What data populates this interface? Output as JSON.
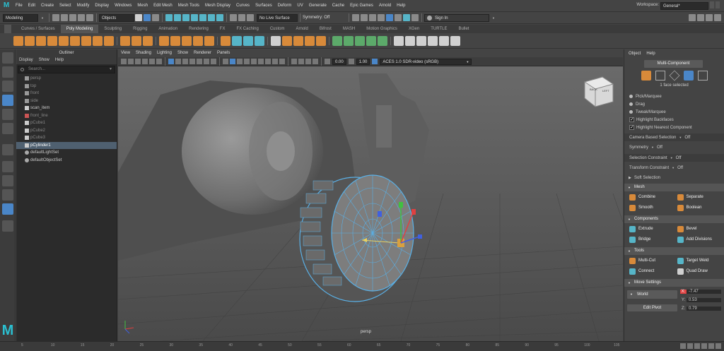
{
  "menubar": {
    "items": [
      "File",
      "Edit",
      "Create",
      "Select",
      "Modify",
      "Display",
      "Windows",
      "Mesh",
      "Edit Mesh",
      "Mesh Tools",
      "Mesh Display",
      "Curves",
      "Surfaces",
      "Deform",
      "UV",
      "Generate",
      "Cache",
      "Epic Games",
      "Arnold",
      "Help"
    ],
    "workspace_label": "Workspace:",
    "workspace_value": "General*"
  },
  "status": {
    "mode": "Modeling",
    "objects": "Objects",
    "live_surface": "No Live Surface",
    "symmetry": "Symmetry: Off",
    "signin": "Sign In"
  },
  "shelf_tabs": [
    "Curves / Surfaces",
    "Poly Modeling",
    "Sculpting",
    "Rigging",
    "Animation",
    "Rendering",
    "FX",
    "FX Caching",
    "Custom",
    "Arnold",
    "Bifrost",
    "MASH",
    "Motion Graphics",
    "XGen",
    "TURTLE",
    "Bullet"
  ],
  "active_shelf_tab": 1,
  "outliner": {
    "title": "Outliner",
    "menu": [
      "Display",
      "Show",
      "Help"
    ],
    "search_placeholder": "Search...",
    "items": [
      {
        "label": "persp",
        "kind": "camera",
        "dim": true
      },
      {
        "label": "top",
        "kind": "camera",
        "dim": true
      },
      {
        "label": "front",
        "kind": "camera",
        "dim": true
      },
      {
        "label": "side",
        "kind": "camera",
        "dim": true
      },
      {
        "label": "scan_item",
        "kind": "mesh",
        "dim": false
      },
      {
        "label": "front_line",
        "kind": "curve",
        "dim": true
      },
      {
        "label": "pCube1",
        "kind": "mesh",
        "dim": true
      },
      {
        "label": "pCube2",
        "kind": "mesh",
        "dim": true
      },
      {
        "label": "pCube3",
        "kind": "mesh",
        "dim": true
      },
      {
        "label": "pCylinder1",
        "kind": "mesh",
        "dim": false,
        "selected": true
      },
      {
        "label": "defaultLightSet",
        "kind": "set",
        "dim": false
      },
      {
        "label": "defaultObjectSet",
        "kind": "set",
        "dim": false
      }
    ]
  },
  "viewport": {
    "menu": [
      "View",
      "Shading",
      "Lighting",
      "Show",
      "Renderer",
      "Panels"
    ],
    "val1": "0.00",
    "val2": "1.00",
    "colorspace": "ACES 1.0 SDR-video (sRGB)",
    "camera": "persp",
    "cube_labels": [
      "BACK",
      "LEFT"
    ]
  },
  "panel": {
    "menu": [
      "Object",
      "Help"
    ],
    "mode": "Multi-Component",
    "selection_info": "1 face selected",
    "radios": [
      "Pick/Marquee",
      "Drag",
      "Tweak/Marquee"
    ],
    "checks": [
      "Highlight Backfaces",
      "Highlight Nearest Component"
    ],
    "camera_sel": {
      "label": "Camera Based Selection",
      "value": "Off"
    },
    "symmetry": {
      "label": "Symmetry",
      "value": "Off"
    },
    "sel_constraint": {
      "label": "Selection Constraint",
      "value": "Off"
    },
    "trans_constraint": {
      "label": "Transform Constraint",
      "value": "Off"
    },
    "soft": "Soft Selection",
    "mesh_hdr": "Mesh",
    "mesh": [
      "Combine",
      "Separate",
      "Smooth",
      "Boolean"
    ],
    "comp_hdr": "Components",
    "comp": [
      "Extrude",
      "Bevel",
      "Bridge",
      "Add Divisions"
    ],
    "tools_hdr": "Tools",
    "tools": [
      "Multi-Cut",
      "Target Weld",
      "Connect",
      "Quad Draw"
    ],
    "move_hdr": "Move Settings",
    "world": "World",
    "edit_pivot": "Edit Pivot",
    "coords": {
      "x_label": "X:",
      "x": "-7.47",
      "y_label": "Y:",
      "y": "0.53",
      "z_label": "Z:",
      "z": "0.79"
    }
  },
  "timeline": {
    "ticks": [
      "5",
      "10",
      "15",
      "20",
      "25",
      "30",
      "35",
      "40",
      "45",
      "50",
      "55",
      "60",
      "65",
      "70",
      "75",
      "80",
      "85",
      "90",
      "95",
      "100",
      "105"
    ]
  },
  "colors": {
    "accent": "#4a86c8",
    "selection": "#5ab0e6",
    "manip_x": "#e04040",
    "manip_y": "#40c040",
    "manip_z": "#4060e0"
  }
}
